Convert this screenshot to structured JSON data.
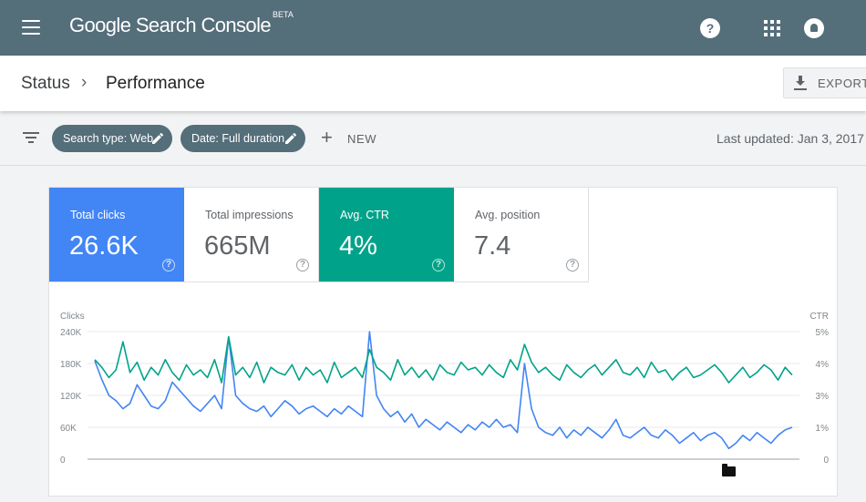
{
  "app": {
    "logo_text": "Google Search Console",
    "logo_badge": "BETA",
    "icons": [
      "menu-icon",
      "help-icon",
      "apps-icon",
      "notifications-icon"
    ]
  },
  "breadcrumb": {
    "parent": "Status",
    "separator": "›",
    "current": "Performance"
  },
  "toolbar": {
    "export_label": "EXPORT"
  },
  "filters": {
    "chips": [
      {
        "label": "Search type: Web"
      },
      {
        "label": "Date: Full duration"
      }
    ],
    "new_plus": "+",
    "new_label": "NEW",
    "last_updated": "Last updated: Jan 3, 2017"
  },
  "metrics": [
    {
      "label": "Total clicks",
      "value": "26.6K",
      "selected": true,
      "color": "#4285f4"
    },
    {
      "label": "Total impressions",
      "value": "665M",
      "selected": false
    },
    {
      "label": "Avg. CTR",
      "value": "4%",
      "selected": true,
      "color": "#00a389"
    },
    {
      "label": "Avg. position",
      "value": "7.4",
      "selected": false
    }
  ],
  "colors": {
    "topbar": "#546e7a",
    "clicks": "#4285f4",
    "ctr": "#00a389"
  },
  "chart_data": {
    "type": "line",
    "y_left_label": "Clicks",
    "y_right_label": "CTR",
    "y_left_ticks": [
      "240K",
      "180K",
      "120K",
      "60K",
      "0"
    ],
    "y_right_ticks": [
      "5%",
      "4%",
      "3%",
      "1%",
      "0"
    ],
    "ylim_left": [
      0,
      240000
    ],
    "ylim_right": [
      0,
      5
    ],
    "grid": true,
    "series": [
      {
        "name": "Clicks",
        "axis": "left",
        "color": "#4285f4",
        "values": [
          185000,
          150000,
          120000,
          110000,
          95000,
          105000,
          140000,
          120000,
          100000,
          95000,
          110000,
          145000,
          130000,
          115000,
          100000,
          90000,
          105000,
          120000,
          95000,
          230000,
          120000,
          105000,
          95000,
          90000,
          100000,
          80000,
          95000,
          110000,
          100000,
          85000,
          95000,
          100000,
          90000,
          80000,
          95000,
          85000,
          100000,
          90000,
          80000,
          240000,
          120000,
          95000,
          80000,
          90000,
          70000,
          85000,
          60000,
          75000,
          65000,
          55000,
          70000,
          60000,
          50000,
          65000,
          55000,
          70000,
          60000,
          75000,
          60000,
          65000,
          50000,
          180000,
          95000,
          60000,
          50000,
          45000,
          60000,
          40000,
          55000,
          45000,
          60000,
          50000,
          40000,
          55000,
          75000,
          45000,
          40000,
          50000,
          60000,
          45000,
          40000,
          55000,
          45000,
          30000,
          40000,
          50000,
          35000,
          45000,
          50000,
          40000,
          20000,
          30000,
          45000,
          35000,
          50000,
          40000,
          30000,
          45000,
          55000,
          60000
        ]
      },
      {
        "name": "CTR",
        "axis": "right",
        "color": "#00a389",
        "values": [
          3.9,
          3.6,
          3.2,
          3.5,
          4.6,
          3.4,
          3.8,
          3.1,
          3.6,
          3.3,
          3.9,
          3.4,
          3.1,
          3.7,
          3.3,
          3.5,
          3.2,
          3.9,
          3.0,
          4.8,
          3.3,
          3.6,
          3.2,
          3.8,
          3.0,
          3.6,
          3.4,
          3.3,
          3.7,
          3.1,
          3.6,
          3.3,
          3.5,
          3.0,
          3.8,
          3.2,
          3.4,
          3.6,
          3.2,
          4.3,
          3.6,
          3.4,
          3.1,
          3.9,
          3.3,
          3.6,
          3.2,
          3.5,
          3.1,
          3.7,
          3.4,
          3.3,
          3.8,
          3.5,
          3.6,
          3.3,
          3.7,
          3.4,
          3.2,
          3.9,
          3.5,
          4.5,
          3.8,
          3.4,
          3.6,
          3.3,
          3.1,
          3.7,
          3.4,
          3.2,
          3.5,
          3.7,
          3.3,
          3.6,
          3.9,
          3.4,
          3.3,
          3.6,
          3.2,
          3.8,
          3.4,
          3.5,
          3.1,
          3.4,
          3.6,
          3.2,
          3.3,
          3.5,
          3.7,
          3.4,
          3.0,
          3.3,
          3.6,
          3.2,
          3.4,
          3.7,
          3.5,
          3.1,
          3.6,
          3.3
        ]
      }
    ]
  }
}
